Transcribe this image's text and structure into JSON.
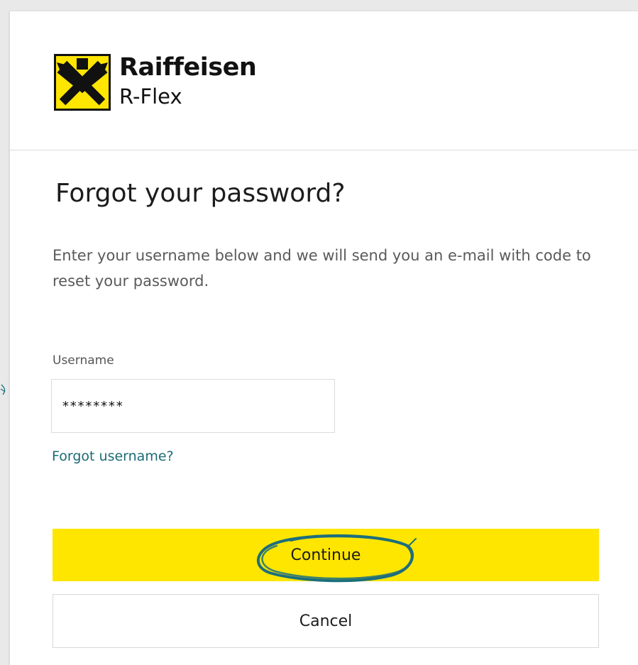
{
  "brand": {
    "name": "Raiffeisen",
    "product": "R-Flex"
  },
  "page": {
    "title": "Forgot your password?",
    "description": "Enter your username below and we will send you an e-mail with code to reset your password."
  },
  "form": {
    "username_label": "Username",
    "username_value": "********",
    "forgot_username_link": "Forgot username?"
  },
  "actions": {
    "continue_label": "Continue",
    "cancel_label": "Cancel"
  },
  "colors": {
    "brand_yellow": "#fee600",
    "link_teal": "#1a6b74",
    "annotation_teal": "#1d6f7c"
  },
  "icons": {
    "logo": "raiffeisen-crossed-gables-logo",
    "annotation": "hand-drawn-circle"
  }
}
